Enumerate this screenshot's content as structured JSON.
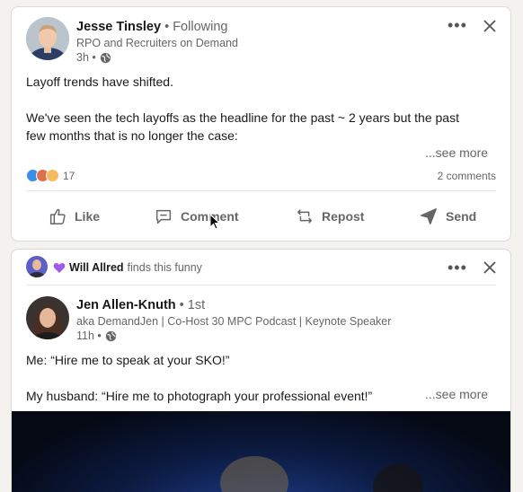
{
  "post1": {
    "author_name": "Jesse Tinsley",
    "relation": "• Following",
    "headline": "RPO and Recruiters on Demand",
    "time": "3h •",
    "body_line1": "Layoff trends have shifted.",
    "body_line2": "We've seen the tech layoffs as the headline for the past ~ 2 years but the past",
    "body_line3": "few months that is no longer the case:",
    "see_more": "...see more",
    "reaction_count": "17",
    "comments": "2 comments",
    "actions": {
      "like": "Like",
      "comment": "Comment",
      "repost": "Repost",
      "send": "Send"
    }
  },
  "post2": {
    "social_actor": "Will Allred",
    "social_text": "finds this funny",
    "author_name": "Jen Allen-Knuth",
    "relation": "• 1st",
    "headline": "aka DemandJen | Co-Host 30 MPC Podcast | Keynote Speaker",
    "time": "11h •",
    "body_line1": "Me: “Hire me to speak at your SKO!”",
    "body_line2": "My husband: “Hire me to photograph your professional event!”",
    "see_more": "...see more"
  },
  "colors": {
    "like_blue": "#378fe9",
    "love_red": "#df704d",
    "funny_teal": "#44712e",
    "insightful_yellow": "#f5bb5c",
    "muted_text": "#666666"
  },
  "icons": [
    "more-options-icon",
    "close-icon",
    "globe-icon",
    "like-icon",
    "comment-icon",
    "repost-icon",
    "send-icon",
    "heart-purple-icon"
  ]
}
